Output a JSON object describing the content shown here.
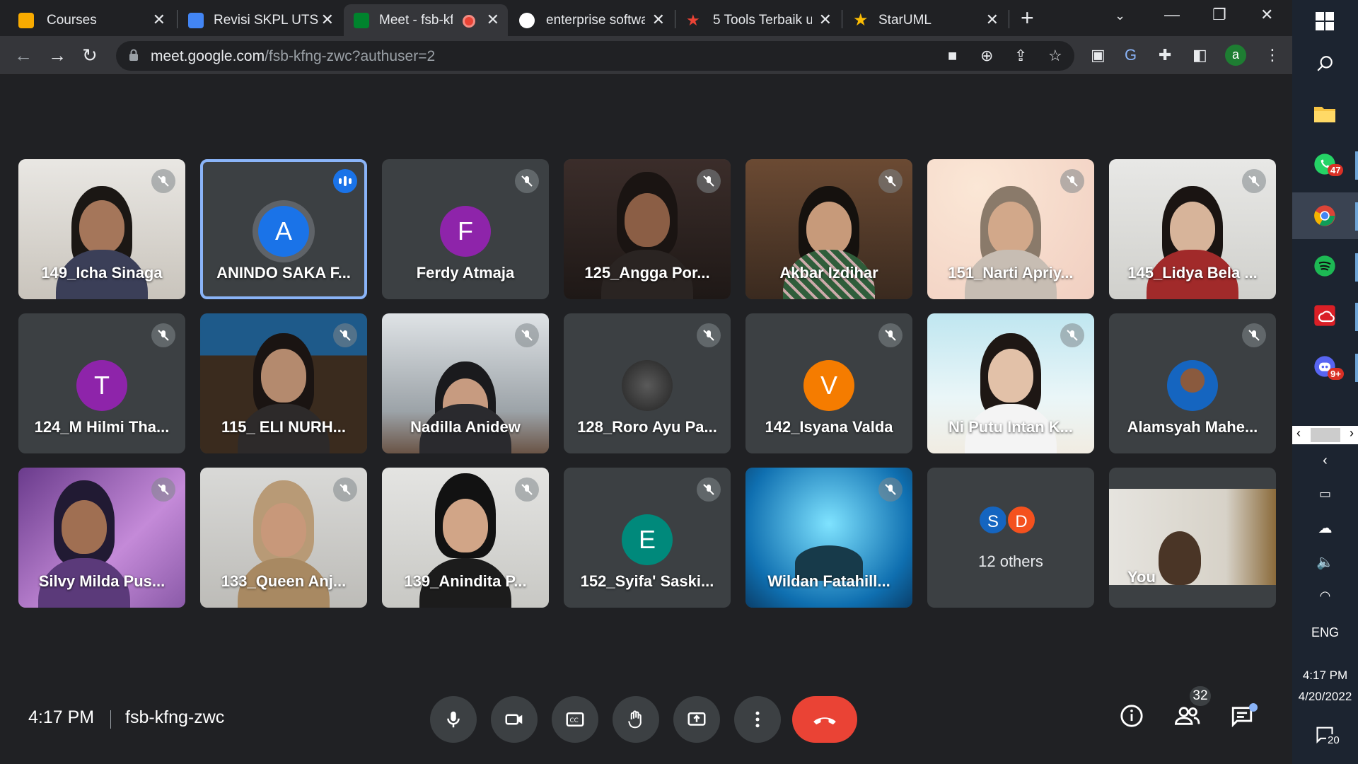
{
  "browser": {
    "tabs": [
      {
        "title": "Courses"
      },
      {
        "title": "Revisi SKPL UTS"
      },
      {
        "title": "Meet - fsb-kf"
      },
      {
        "title": "enterprise softwa"
      },
      {
        "title": "5 Tools Terbaik u"
      },
      {
        "title": "StarUML"
      }
    ],
    "url_host": "meet.google.com",
    "url_path": "/fsb-kfng-zwc?authuser=2",
    "profile_initial": "a"
  },
  "meet": {
    "participants": [
      {
        "name": "149_Icha Sinaga",
        "type": "video"
      },
      {
        "name": "ANINDO SAKA F...",
        "type": "avatar",
        "initial": "A",
        "speaking": true
      },
      {
        "name": "Ferdy Atmaja",
        "type": "avatar",
        "initial": "F"
      },
      {
        "name": "125_Angga Por...",
        "type": "video"
      },
      {
        "name": "Akbar Izdihar",
        "type": "video"
      },
      {
        "name": "151_Narti Apriy...",
        "type": "video"
      },
      {
        "name": "145_Lidya Bela ...",
        "type": "video"
      },
      {
        "name": "124_M Hilmi Tha...",
        "type": "avatar",
        "initial": "T"
      },
      {
        "name": "115_ ELI NURH...",
        "type": "video"
      },
      {
        "name": "Nadilla Anidew",
        "type": "video"
      },
      {
        "name": "128_Roro Ayu Pa...",
        "type": "photo"
      },
      {
        "name": "142_Isyana Valda",
        "type": "avatar",
        "initial": "V"
      },
      {
        "name": "Ni Putu Intan K...",
        "type": "video"
      },
      {
        "name": "Alamsyah Mahe...",
        "type": "photo"
      },
      {
        "name": "Silvy Milda Pus...",
        "type": "video"
      },
      {
        "name": "133_Queen Anj...",
        "type": "video"
      },
      {
        "name": "139_Anindita P...",
        "type": "video"
      },
      {
        "name": "152_Syifa' Saski...",
        "type": "avatar",
        "initial": "E"
      },
      {
        "name": "Wildan Fatahill...",
        "type": "video"
      }
    ],
    "others": {
      "initials": [
        "S",
        "D"
      ],
      "label": "12 others"
    },
    "self_label": "You",
    "time": "4:17 PM",
    "code": "fsb-kfng-zwc",
    "people_count": "32"
  },
  "taskbar": {
    "whatsapp_badge": "47",
    "discord_badge": "9+",
    "lang": "ENG",
    "time": "4:17 PM",
    "date": "4/20/2022",
    "notif_count": "20"
  },
  "colors": {
    "speaking_outline": "#8ab4f8",
    "leave_button": "#ea4335",
    "avatar_A": "#1a73e8",
    "avatar_F": "#8e24aa",
    "avatar_T": "#8e24aa",
    "avatar_V": "#f57c00",
    "avatar_E": "#00897b"
  }
}
